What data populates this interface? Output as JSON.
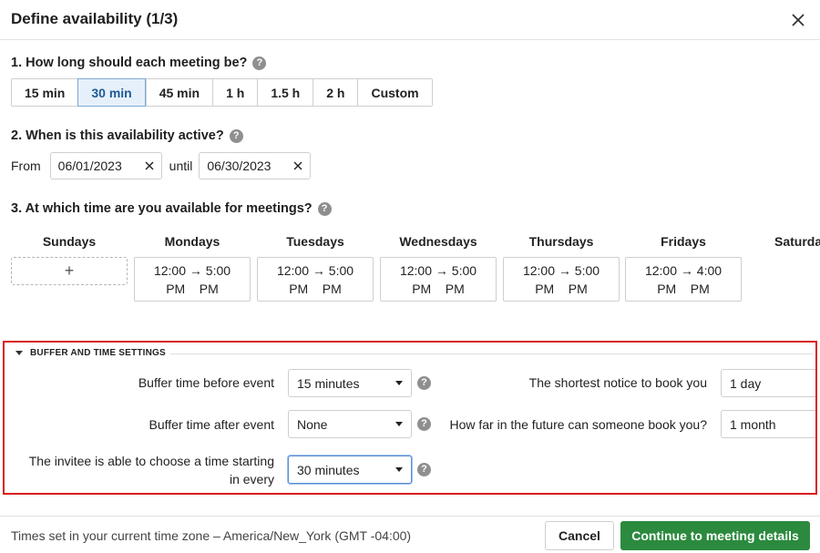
{
  "dialog": {
    "title": "Define availability (1/3)"
  },
  "q1": {
    "label": "1. How long should each meeting be?"
  },
  "durations": [
    {
      "label": "15 min",
      "active": false
    },
    {
      "label": "30 min",
      "active": true
    },
    {
      "label": "45 min",
      "active": false
    },
    {
      "label": "1 h",
      "active": false
    },
    {
      "label": "1.5 h",
      "active": false
    },
    {
      "label": "2 h",
      "active": false
    },
    {
      "label": "Custom",
      "active": false
    }
  ],
  "q2": {
    "label": "2. When is this availability active?",
    "from_label": "From",
    "from_value": "06/01/2023",
    "until_label": "until",
    "until_value": "06/30/2023"
  },
  "q3": {
    "label": "3. At which time are you available for meetings?"
  },
  "days": [
    {
      "name": "Sundays",
      "slot": null
    },
    {
      "name": "Mondays",
      "slot": {
        "line1": "12:00 → 5:00",
        "line2": "PM    PM"
      }
    },
    {
      "name": "Tuesdays",
      "slot": {
        "line1": "12:00 → 5:00",
        "line2": "PM    PM"
      }
    },
    {
      "name": "Wednesdays",
      "slot": {
        "line1": "12:00 → 5:00",
        "line2": "PM    PM"
      }
    },
    {
      "name": "Thursdays",
      "slot": {
        "line1": "12:00 → 5:00",
        "line2": "PM    PM"
      }
    },
    {
      "name": "Fridays",
      "slot": {
        "line1": "12:00 → 4:00",
        "line2": "PM    PM"
      }
    },
    {
      "name": "Saturdays",
      "slot": null
    }
  ],
  "add_symbol": "+",
  "buffer": {
    "heading": "BUFFER AND TIME SETTINGS",
    "before_label": "Buffer time before event",
    "before_value": "15 minutes",
    "after_label": "Buffer time after event",
    "after_value": "None",
    "interval_label_line1": "The invitee is able to choose a time starting",
    "interval_label_line2": "in every",
    "interval_value": "30 minutes",
    "notice_label": "The shortest notice to book you",
    "notice_value": "1 day",
    "future_label": "How far in the future can someone book you?",
    "future_value": "1 month"
  },
  "footer": {
    "timezone_text": "Times set in your current time zone – America/New_York (GMT -04:00)",
    "cancel_label": "Cancel",
    "continue_label": "Continue to meeting details"
  },
  "colors": {
    "accent_blue": "#1e5a96",
    "active_bg": "#e6f0fa",
    "highlight_red": "#d81e1e",
    "primary_green": "#2b8a3e"
  },
  "icons": {
    "close": "close-icon",
    "help": "help-icon",
    "clear": "clear-icon",
    "caret": "chevron-down-icon"
  }
}
